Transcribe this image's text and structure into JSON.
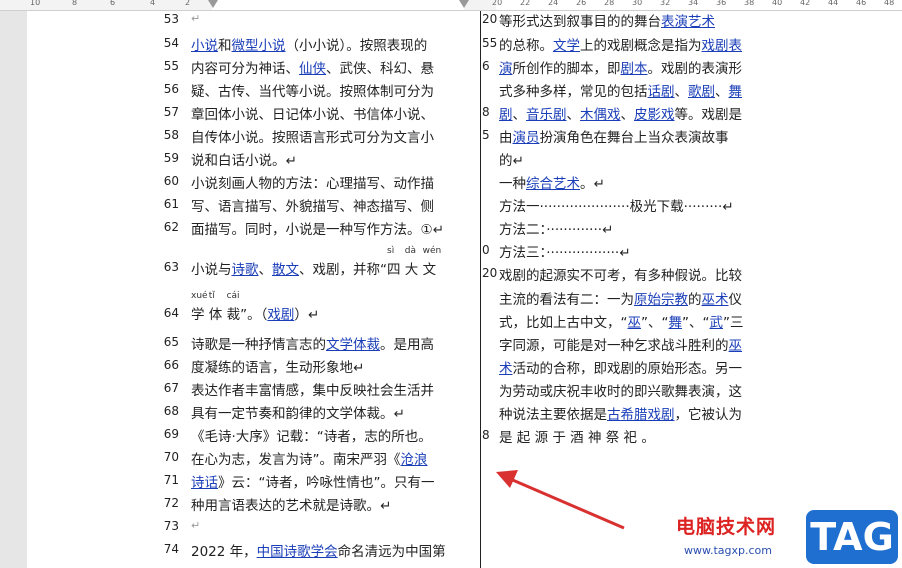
{
  "ruler": {
    "left_ticks": [
      "10",
      "8",
      "6",
      "4",
      "2"
    ],
    "right_ticks": [
      "20",
      "22",
      "24",
      "26",
      "28",
      "30",
      "32",
      "34",
      "36",
      "38",
      "40",
      "42",
      "44",
      "46",
      "48"
    ]
  },
  "left_lines": [
    {
      "n": "53",
      "text": "↵"
    },
    {
      "n": "54",
      "text": ""
    },
    {
      "n": "55",
      "text": ""
    },
    {
      "n": "56",
      "text": "疑、古传、当代等小说。按照体制可分为"
    },
    {
      "n": "57",
      "text": "章回体小说、日记体小说、书信体小说、"
    },
    {
      "n": "58",
      "text": "自传体小说。按照语言形式可分为文言小"
    },
    {
      "n": "59",
      "text": "说和白话小说。↵"
    },
    {
      "n": "60",
      "text": "小说刻画人物的方法：心理描写、动作描"
    },
    {
      "n": "61",
      "text": "写、语言描写、外貌描写、神态描写、侧"
    },
    {
      "n": "62",
      "text": "面描写。同时，小说是一种写作方法。①↵"
    },
    {
      "n": "63",
      "text": ""
    },
    {
      "n": "64",
      "text": ""
    },
    {
      "n": "65",
      "text": ""
    },
    {
      "n": "66",
      "text": "度凝练的语言，生动形象地↵"
    },
    {
      "n": "67",
      "text": "表达作者丰富情感，集中反映社会生活并"
    },
    {
      "n": "68",
      "text": "具有一定节奏和韵律的文学体裁。↵"
    },
    {
      "n": "69",
      "text": "《毛诗·大序》记载：“诗者，志的所也。"
    },
    {
      "n": "70",
      "text": ""
    },
    {
      "n": "71",
      "text": ""
    },
    {
      "n": "72",
      "text": "种用言语表达的艺术就是诗歌。↵"
    },
    {
      "n": "73",
      "text": "↵"
    },
    {
      "n": "74",
      "text": ""
    }
  ],
  "links": {
    "l54a": "小说",
    "l54b": "微型小说",
    "l54c": "（小小说）。按照表现的",
    "l54and": "和",
    "l55a": "内容可分为神话、",
    "l55b": "仙侠",
    "l55c": "、武侠、科幻、悬",
    "l63a": "小说与",
    "l63b": "诗歌",
    "l63c": "、",
    "l63d": "散文",
    "l63e": "、戏剧，并称“",
    "l63r1": "四",
    "l63p1": "sì",
    "l63r2": "大",
    "l63p2": "dà",
    "l63r3": "文",
    "l63p3": "wén",
    "l64r1": "学",
    "l64p1": "xué",
    "l64r2": "体",
    "l64p2": "tǐ",
    "l64r3": "裁",
    "l64p3": "cái",
    "l64a": "”。（",
    "l64b": "戏剧",
    "l64c": "）↵",
    "l65a": "诗歌是一种抒情言志的",
    "l65b": "文学体裁",
    "l65c": "。是用高",
    "l70a": "在心为志，发言为诗”。南宋严羽《",
    "l70b": "沧浪",
    "l71a": "诗话",
    "l71b": "》云：“诗者，吟咏性情也”。只有一",
    "l74a": "2022 年，",
    "l74b": "中国诗歌学会",
    "l74c": "命名清远为中国第"
  },
  "right": {
    "r0a": "等形式达到叙事目的的舞台",
    "r0b": "表演艺术",
    "r1a": "的总称。",
    "r1b": "文学",
    "r1c": "上的戏剧概念是指为",
    "r1d": "戏剧表",
    "r2a": "演",
    "r2b": "所创作的脚本，即",
    "r2c": "剧本",
    "r2d": "。戏剧的表演形",
    "r3": "式多种多样，常见的包括",
    "r3b": "话剧",
    "r3c": "、",
    "r3d": "歌剧",
    "r3e": "、",
    "r3f": "舞",
    "r4a": "剧",
    "r4b": "、",
    "r4c": "音乐剧",
    "r4d": "、",
    "r4e": "木偶戏",
    "r4f": "、",
    "r4g": "皮影戏",
    "r4h": "等。戏剧是",
    "r5a": "由",
    "r5b": "演员",
    "r5c": "扮演角色在舞台上当众表演故事",
    "r6": "的↵",
    "r7a": "一种",
    "r7b": "综合艺术",
    "r7c": "。↵",
    "r8": "方法一·····················极光下载·········↵",
    "r9": "方法二：·············↵",
    "r10": "方法三：·················↵",
    "r11": "戏剧的起源实不可考，有多种假说。比较",
    "r12a": "主流的看法有二：一为",
    "r12b": "原始宗教",
    "r12c": "的",
    "r12d": "巫术",
    "r12e": "仪",
    "r13a": "式，比如上古中文，“",
    "r13b": "巫",
    "r13c": "”、“",
    "r13d": "舞",
    "r13e": "”、“",
    "r13f": "武",
    "r13g": "”三",
    "r14a": "字同源，可能是对一种乞求战斗胜利的",
    "r14b": "巫",
    "r15a": "术",
    "r15b": "活动的合称，即戏剧的原始形态。另一",
    "r16": "为劳动或庆祝丰收时的即兴歌舞表演，这",
    "r17a": "种说法主要依据是",
    "r17b": "古希腊戏剧",
    "r17c": "，它被认为",
    "r18": "是    起    源    于    酒    神    祭    祀    。",
    "rnums": [
      "20",
      "55",
      "6",
      "",
      "8",
      "5",
      "",
      "",
      "",
      "",
      "0",
      "20",
      "",
      "",
      "",
      "",
      "",
      "",
      "8"
    ]
  },
  "watermark": {
    "site": "电脑技术网",
    "url": "www.tagxp.com",
    "tag": "TAG"
  },
  "colors": {
    "link": "#1a3eb8",
    "arrow": "#d93030",
    "tag_bg": "#1f6fd1"
  }
}
